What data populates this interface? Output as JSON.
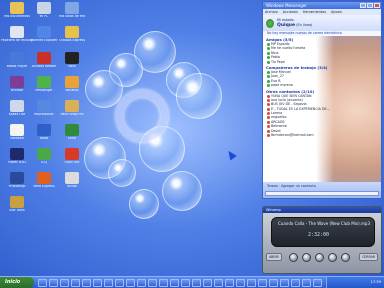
{
  "desktop": {
    "icons": [
      {
        "label": "Mis documentos",
        "color": "#e8c458"
      },
      {
        "label": "Mi PC",
        "color": "#c9d4e8"
      },
      {
        "label": "Mis sitios de red",
        "color": "#7fa6e6"
      },
      {
        "label": "Papelera de reciclaje",
        "color": "#dfe6f2"
      },
      {
        "label": "Internet Explorer",
        "color": "#4f86e8"
      },
      {
        "label": "Outlook Express",
        "color": "#e6c24a"
      },
      {
        "label": "Media Player",
        "color": "#4a78d8"
      },
      {
        "label": "Acrobat Reader",
        "color": "#c8302a"
      },
      {
        "label": "Nero",
        "color": "#222222"
      },
      {
        "label": "WinRAR",
        "color": "#7c3c98"
      },
      {
        "label": "Messenger",
        "color": "#4fb34a"
      },
      {
        "label": "Winamp",
        "color": "#e9a23a"
      },
      {
        "label": "Kazaa Lite",
        "color": "#cfd8e8"
      },
      {
        "label": "Reproductor",
        "color": "#5a88e0"
      },
      {
        "label": "Paint Shop Pro",
        "color": "#d9b05a"
      },
      {
        "label": "Notepad",
        "color": "#f4f4f4"
      },
      {
        "label": "Word",
        "color": "#2f5fc8"
      },
      {
        "label": "Excel",
        "color": "#2f8a3a"
      },
      {
        "label": "Power DVD",
        "color": "#1e2a6a"
      },
      {
        "label": "ICQ",
        "color": "#4aa84a"
      },
      {
        "label": "Flash Get",
        "color": "#d83a2a"
      },
      {
        "label": "Photoshop",
        "color": "#2a4a9a"
      },
      {
        "label": "Nero Express",
        "color": "#e06020"
      },
      {
        "label": "Atube",
        "color": "#dcdcdc"
      },
      {
        "label": "Star Wars",
        "color": "#c8a040"
      }
    ]
  },
  "messenger": {
    "title": "Windows Messenger",
    "menu": [
      "Archivo",
      "Acciones",
      "Herramientas",
      "Ayuda"
    ],
    "status_line": "Mi estado:",
    "user_name": "Quique",
    "user_status": "(En línea)",
    "mail_notice": "No hay mensajes nuevos de correo electrónico",
    "groups": [
      {
        "name": "Amigos (5/5)",
        "contacts": [
          "MP Espaillo",
          "Me he vuelto fumeta",
          "Nina",
          "Pablo",
          "Tio Pepe"
        ],
        "offline": false
      },
      {
        "name": "Compañeros de trabajo (3/4)",
        "contacts": [
          "Jose Manuel",
          "Juan_27",
          "Eva R.",
          "pepe moreno"
        ],
        "offline": false
      },
      {
        "name": "Otros contactos (2/10)",
        "contacts": [
          "YUNA QUE SIEN CANTAN",
          "ana lucia (ausente)",
          "BUS JUV DE - Segovia",
          "P... TUDAL ES LA EXPERIENCIA DE...",
          "Lorena",
          "miguelito",
          "ARCADE",
          "Belmonte",
          "David",
          "fbrmdecars@hotmail.com"
        ],
        "offline": true
      }
    ],
    "footer_add": "Agregar un contacto",
    "footer_label": "Tareas"
  },
  "player": {
    "title": "Winamp",
    "track": "Cuando Calla - The Wave (New Club Mix).mp3",
    "time": "2:32:00",
    "left_button": "ABRIR",
    "right_button": "CERRAR"
  },
  "taskbar": {
    "start_label": "Inicio",
    "clock": "17:59"
  },
  "colors": {
    "accent": "#2c5ad2",
    "online": "#39a640",
    "offline": "#d04a3a"
  }
}
